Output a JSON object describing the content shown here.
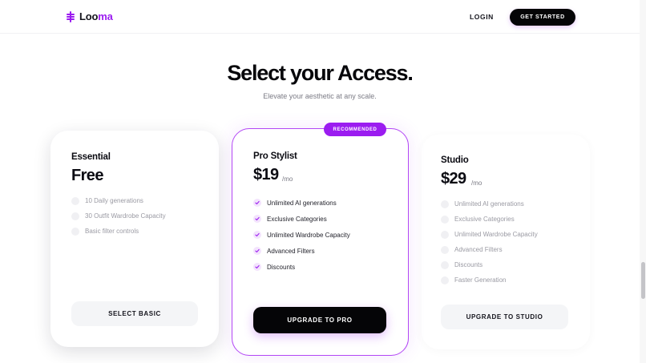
{
  "nav": {
    "logo": {
      "prefix": "Loo",
      "accent": "ma"
    },
    "login_label": "LOGIN",
    "cta_label": "GET STARTED"
  },
  "hero": {
    "title": "Select your Access.",
    "subtitle": "Elevate your aesthetic at any scale."
  },
  "plans": [
    {
      "name": "Essential",
      "price": "Free",
      "period": "",
      "features": [
        "10 Daily generations",
        "30 Outfit Wardrobe Capacity",
        "Basic filter controls"
      ],
      "button_label": "SELECT BASIC"
    },
    {
      "badge": "RECOMMENDED",
      "name": "Pro Stylist",
      "price": "$19",
      "period": "/mo",
      "features": [
        "Unlimited AI generations",
        "Exclusive Categories",
        "Unlimited Wardrobe Capacity",
        "Advanced Filters",
        "Discounts"
      ],
      "button_label": "UPGRADE TO PRO"
    },
    {
      "name": "Studio",
      "price": "$29",
      "period": "/mo",
      "features": [
        "Unlimited AI generations",
        "Exclusive Categories",
        "Unlimited Wardrobe Capacity",
        "Advanced Filters",
        "Discounts",
        "Faster Generation"
      ],
      "button_label": "UPGRADE TO STUDIO"
    }
  ],
  "colors": {
    "accent": "#9b1cf0",
    "dark_button": "#050507",
    "muted_text": "#7b7b85"
  },
  "icons": {
    "logo": "logo-icon",
    "check": "check-icon"
  }
}
